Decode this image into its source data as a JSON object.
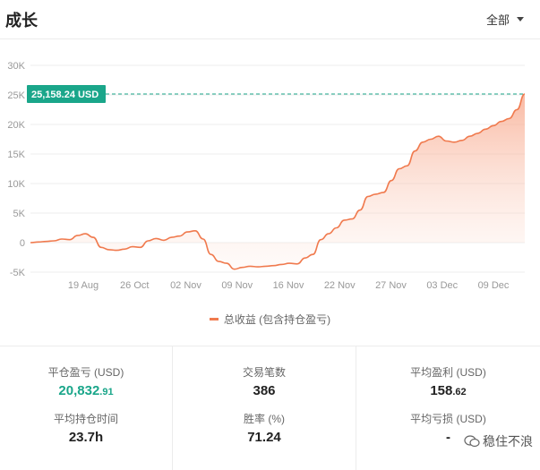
{
  "header": {
    "title": "成长",
    "filter_label": "全部"
  },
  "chart_data": {
    "type": "area",
    "yticks": [
      "30K",
      "25K",
      "20K",
      "15K",
      "10K",
      "5K",
      "0",
      "-5K"
    ],
    "ytick_values": [
      30000,
      25000,
      20000,
      15000,
      10000,
      5000,
      0,
      -5000
    ],
    "ylim": [
      -5000,
      30000
    ],
    "xticks": [
      "19 Aug",
      "26 Oct",
      "02 Nov",
      "09 Nov",
      "16 Nov",
      "22 Nov",
      "27 Nov",
      "03 Dec",
      "09 Dec"
    ],
    "current_label": "25,158.24 USD",
    "current_value": 25158.24,
    "series": [
      {
        "name": "总收益 (包含持仓盈亏)",
        "values": [
          0,
          100,
          200,
          300,
          600,
          500,
          1200,
          1500,
          900,
          -800,
          -1200,
          -1300,
          -1100,
          -700,
          -800,
          300,
          700,
          400,
          900,
          1100,
          1800,
          2000,
          600,
          -2000,
          -3200,
          -3500,
          -4500,
          -4200,
          -4000,
          -4100,
          -4000,
          -3900,
          -3700,
          -3500,
          -3600,
          -2600,
          -2000,
          500,
          1500,
          2500,
          3800,
          4000,
          5500,
          7800,
          8200,
          8500,
          10500,
          12500,
          13000,
          15500,
          17000,
          17500,
          18000,
          17200,
          17000,
          17300,
          18000,
          18500,
          19200,
          19800,
          20500,
          21000,
          22500,
          25158
        ]
      }
    ],
    "colors": {
      "line": "#f07a4e",
      "fill": "#fde4da",
      "label_bg": "#1aa68a",
      "dashed": "#1aa68a"
    }
  },
  "legend": {
    "label": "总收益 (包含持仓盈亏)"
  },
  "stats": {
    "realized_pnl": {
      "label": "平仓盈亏 (USD)",
      "int": "20,832",
      "frac": ".91"
    },
    "avg_hold": {
      "label": "平均持仓时间",
      "value": "23.7h"
    },
    "trades": {
      "label": "交易笔数",
      "value": "386"
    },
    "win_rate": {
      "label": "胜率 (%)",
      "value": "71.24"
    },
    "avg_profit": {
      "label": "平均盈利 (USD)",
      "int": "158",
      "frac": ".62"
    },
    "avg_loss": {
      "label": "平均亏损 (USD)",
      "value": "-"
    }
  },
  "watermark": {
    "text": "稳住不浪"
  }
}
